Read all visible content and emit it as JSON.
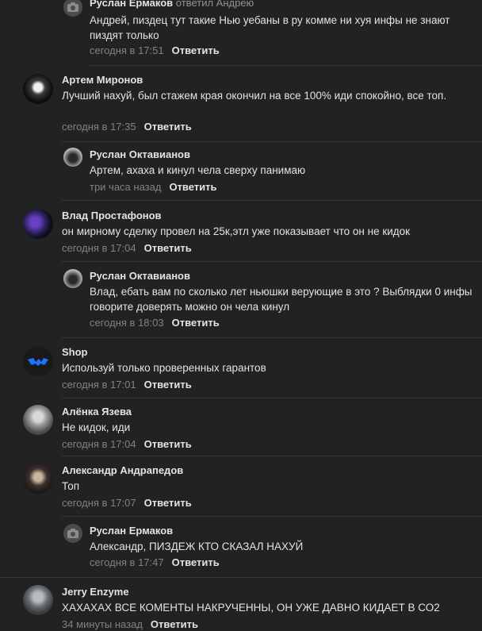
{
  "c0": {
    "author": "Руслан Ермаков",
    "reply_to": "ответил Андрею",
    "text": "Андрей, пиздец тут такие Нью уебаны в ру комме ни хуя инфы не знают пиздят только",
    "time": "сегодня в 17:51",
    "reply_label": "Ответить",
    "avatar": "camera-icon"
  },
  "c1": {
    "author": "Артем Миронов",
    "text": "Лучший нахуй, был стажем края окончил на все 100% иди спокойно, все топ.",
    "time": "сегодня в 17:35",
    "reply_label": "Ответить"
  },
  "c2": {
    "author": "Руслан Октавианов",
    "text": "Артем, ахаха и кинул чела сверху панимаю",
    "time": "три часа назад",
    "reply_label": "Ответить"
  },
  "c3": {
    "author": "Влад Простафонов",
    "text": "он мирному сделку провел на 25к,этл уже показывает что он не кидок",
    "time": "сегодня в 17:04",
    "reply_label": "Ответить"
  },
  "c4": {
    "author": "Руслан Октавианов",
    "text": "Влад, ебать вам по сколько лет ньюшки верующие в это ? Выблядки 0 инфы говорите доверять можно он чела кинул",
    "time": "сегодня в 18:03",
    "reply_label": "Ответить"
  },
  "c5": {
    "author": "Shop",
    "text": "Используй только проверенных гарантов",
    "time": "сегодня в 17:01",
    "reply_label": "Ответить"
  },
  "c6": {
    "author": "Алёнка Язева",
    "text": "Не кидок, иди",
    "time": "сегодня в 17:04",
    "reply_label": "Ответить"
  },
  "c7": {
    "author": "Александр Андрапедов",
    "text": "Топ",
    "time": "сегодня в 17:07",
    "reply_label": "Ответить"
  },
  "c8": {
    "author": "Руслан Ермаков",
    "text": "Александр, ПИЗДЕЖ КТО СКАЗАЛ НАХУЙ",
    "time": "сегодня в 17:47",
    "reply_label": "Ответить",
    "avatar": "camera-icon"
  },
  "c9": {
    "author": "Jerry Enzyme",
    "text": "ХАХАХАХ ВСЕ КОМЕНТЫ НАКРУЧЕННЫ, ОН УЖЕ ДАВНО КИДАЕТ В СО2",
    "time": "34 минуты назад",
    "reply_label": "Ответить"
  }
}
